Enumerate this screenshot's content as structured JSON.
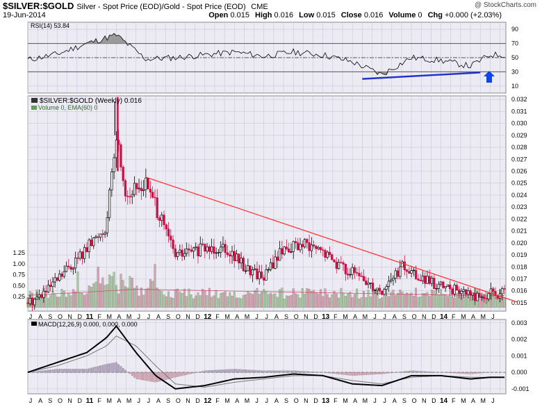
{
  "header": {
    "symbol": "$SILVER:$GOLD",
    "description": "Silver - Spot Price (EOD)/Gold - Spot Price (EOD)",
    "exchange": "CME",
    "date": "19-Jun-2014",
    "open_label": "Open",
    "open": "0.015",
    "high_label": "High",
    "high": "0.016",
    "low_label": "Low",
    "low": "0.015",
    "close_label": "Close",
    "close": "0.016",
    "volume_label": "Volume",
    "volume": "0",
    "chg_label": "Chg",
    "chg": "+0.000 (+2.03%)",
    "logo": "@ StockCharts.com"
  },
  "colors": {
    "panel_bg": "#ecebf4",
    "grid": "#c8c8d8",
    "up": "#000000",
    "down": "#cc1144",
    "trendline": "#ff3333",
    "support_line": "#2233cc",
    "arrow": "#1144ee",
    "volume_up": "#a8c8a0",
    "volume_down": "#d8a0b0",
    "macd_hist": "#b0a0c0"
  },
  "chart_data": [
    {
      "type": "line",
      "legend": "RSI(14) 53.84",
      "y_ticks": [
        10,
        30,
        50,
        70,
        90
      ],
      "ylim": [
        0,
        100
      ],
      "reference_lines": [
        30,
        50,
        70
      ],
      "x": [
        "2010-07",
        "2010-10",
        "2011-01",
        "2011-04",
        "2011-07",
        "2011-10",
        "2012-01",
        "2012-04",
        "2012-07",
        "2012-10",
        "2013-01",
        "2013-04",
        "2013-07",
        "2013-10",
        "2014-01",
        "2014-04",
        "2014-06"
      ],
      "values": [
        47,
        55,
        70,
        82,
        48,
        50,
        54,
        58,
        52,
        58,
        54,
        44,
        26,
        50,
        46,
        38,
        54
      ],
      "annotation_line": {
        "from": [
          "2013-05",
          20
        ],
        "to": [
          "2014-05",
          29
        ]
      }
    },
    {
      "type": "candlestick",
      "legend": "$SILVER:$GOLD (Weekly) 0.016",
      "volume_legend": "Volume 0, EMA(60) 0",
      "y_ticks": [
        0.015,
        0.016,
        0.017,
        0.018,
        0.019,
        0.02,
        0.021,
        0.022,
        0.023,
        0.024,
        0.025,
        0.026,
        0.027,
        0.028,
        0.029,
        0.03,
        0.031,
        0.032
      ],
      "ylim": [
        0.0143,
        0.0323
      ],
      "volume_ticks": [
        0.25,
        0.5,
        0.75,
        1.0,
        1.25
      ],
      "x": [
        "2010-07",
        "2010-09",
        "2010-11",
        "2011-01",
        "2011-03",
        "2011-04",
        "2011-05",
        "2011-07",
        "2011-08",
        "2011-10",
        "2012-01",
        "2012-03",
        "2012-05",
        "2012-07",
        "2012-09",
        "2012-11",
        "2013-01",
        "2013-03",
        "2013-05",
        "2013-07",
        "2013-09",
        "2013-11",
        "2014-01",
        "2014-03",
        "2014-05",
        "2014-06"
      ],
      "close": [
        0.015,
        0.016,
        0.0178,
        0.0195,
        0.0215,
        0.029,
        0.024,
        0.025,
        0.023,
        0.019,
        0.0195,
        0.0198,
        0.018,
        0.0172,
        0.0196,
        0.0198,
        0.0192,
        0.018,
        0.017,
        0.016,
        0.018,
        0.017,
        0.0163,
        0.016,
        0.0154,
        0.0158
      ],
      "trendline": {
        "from": [
          "2011-07",
          0.0255
        ],
        "to": [
          "2014-06",
          0.016
        ]
      },
      "axis_labels": [
        "J",
        "A",
        "S",
        "O",
        "N",
        "D",
        "11",
        "F",
        "M",
        "A",
        "M",
        "J",
        "J",
        "A",
        "S",
        "O",
        "N",
        "D",
        "12",
        "F",
        "M",
        "A",
        "M",
        "J",
        "J",
        "A",
        "S",
        "O",
        "N",
        "D",
        "13",
        "F",
        "M",
        "A",
        "M",
        "J",
        "J",
        "A",
        "S",
        "O",
        "N",
        "D",
        "14",
        "F",
        "M",
        "A",
        "M",
        "J"
      ]
    },
    {
      "type": "line",
      "legend": "MACD(12,26,9) 0.000, 0.000, 0.000",
      "y_ticks": [
        -0.001,
        0.0,
        0.001,
        0.002,
        0.003
      ],
      "ylim": [
        -0.0013,
        0.0032
      ],
      "x": [
        "2010-07",
        "2010-10",
        "2011-01",
        "2011-03",
        "2011-04",
        "2011-06",
        "2011-08",
        "2011-10",
        "2012-01",
        "2012-04",
        "2012-07",
        "2012-10",
        "2013-01",
        "2013-04",
        "2013-07",
        "2013-10",
        "2014-01",
        "2014-04",
        "2014-06"
      ],
      "macd": [
        0.0,
        0.0006,
        0.0012,
        0.0021,
        0.0028,
        0.0012,
        -0.0002,
        -0.001,
        -0.0008,
        -0.0004,
        -0.0003,
        -0.0001,
        -0.0002,
        -0.0007,
        -0.0008,
        -0.0002,
        -0.0002,
        -0.0004,
        -0.0003
      ],
      "signal": [
        0.0,
        0.0004,
        0.001,
        0.0016,
        0.0022,
        0.0016,
        0.0004,
        -0.0007,
        -0.0009,
        -0.0006,
        -0.0004,
        -0.0002,
        -0.0002,
        -0.0005,
        -0.0007,
        -0.0003,
        -0.0002,
        -0.0003,
        -0.0003
      ]
    }
  ]
}
